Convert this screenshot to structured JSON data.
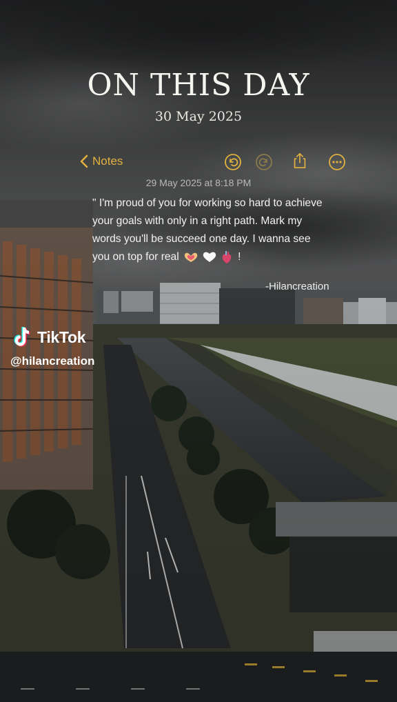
{
  "header": {
    "title": "ON THIS DAY",
    "date": "30 May 2025"
  },
  "toolbar": {
    "back_label": "Notes",
    "accent_color": "#e2b23f",
    "icons": [
      "undo-icon",
      "redo-icon",
      "share-icon",
      "more-icon"
    ]
  },
  "note": {
    "timestamp": "29 May 2025 at 8:18 PM",
    "lines": [
      "\" I'm proud of you for working so hard to achieve",
      "your goals with only in a right path. Mark my",
      "words you'll be succeed one day. I wanna see",
      "you on top for real"
    ],
    "ending_emojis": [
      "heart-hands-icon",
      "white-heart-icon",
      "anatomical-heart-icon"
    ],
    "ending": "!",
    "signature": "-Hilancreation"
  },
  "watermark": {
    "brand": "TikTok",
    "handle": "@hilancreation"
  }
}
